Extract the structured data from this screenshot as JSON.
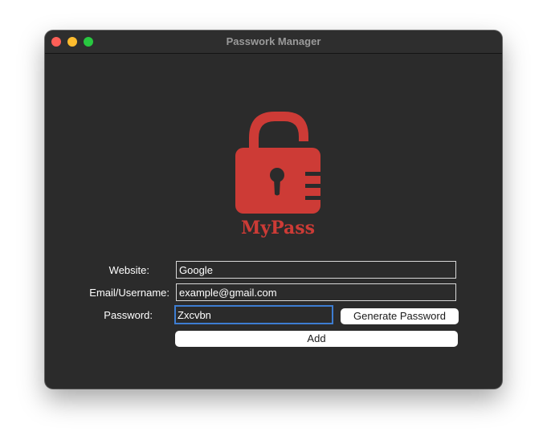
{
  "window": {
    "title": "Passwork Manager"
  },
  "logo": {
    "text": "MyPass",
    "color": "#cd3b36",
    "icon": "padlock-unlocked-icon"
  },
  "form": {
    "website_label": "Website:",
    "website_value": "Google",
    "email_label": "Email/Username:",
    "email_value": "example@gmail.com",
    "password_label": "Password:",
    "password_value": "Zxcvbn",
    "generate_label": "Generate Password",
    "add_label": "Add"
  },
  "colors": {
    "window_bg": "#2b2b2b",
    "focus_ring": "#3d7dd2"
  }
}
